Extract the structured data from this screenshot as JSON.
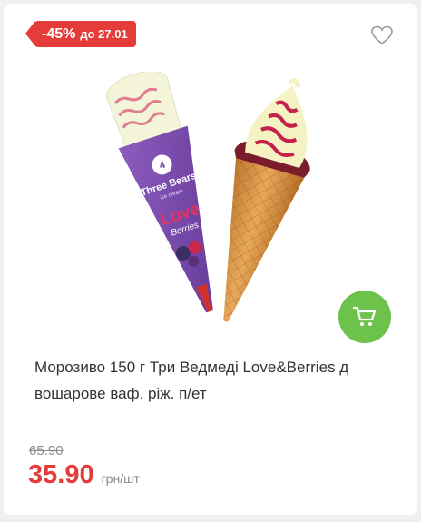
{
  "badge": {
    "percent": "-45%",
    "until": "до 27.01"
  },
  "icons": {
    "favorite": "heart-outline-icon",
    "cart": "cart-icon"
  },
  "image": {
    "brand": "Three Bears",
    "brand_sub": "ice cream",
    "wrapper_line1": "Love",
    "wrapper_line2": "Berries"
  },
  "product": {
    "title": "Морозиво 150 г Три Ведмеді Love&Berries д вошарове ваф. ріж. п/ет",
    "old_price": "65.90",
    "price": "35.90",
    "unit": "грн/шт"
  },
  "colors": {
    "sale": "#e53b3b",
    "cart": "#6cc24a",
    "wrapper": "#7a4ba8"
  }
}
